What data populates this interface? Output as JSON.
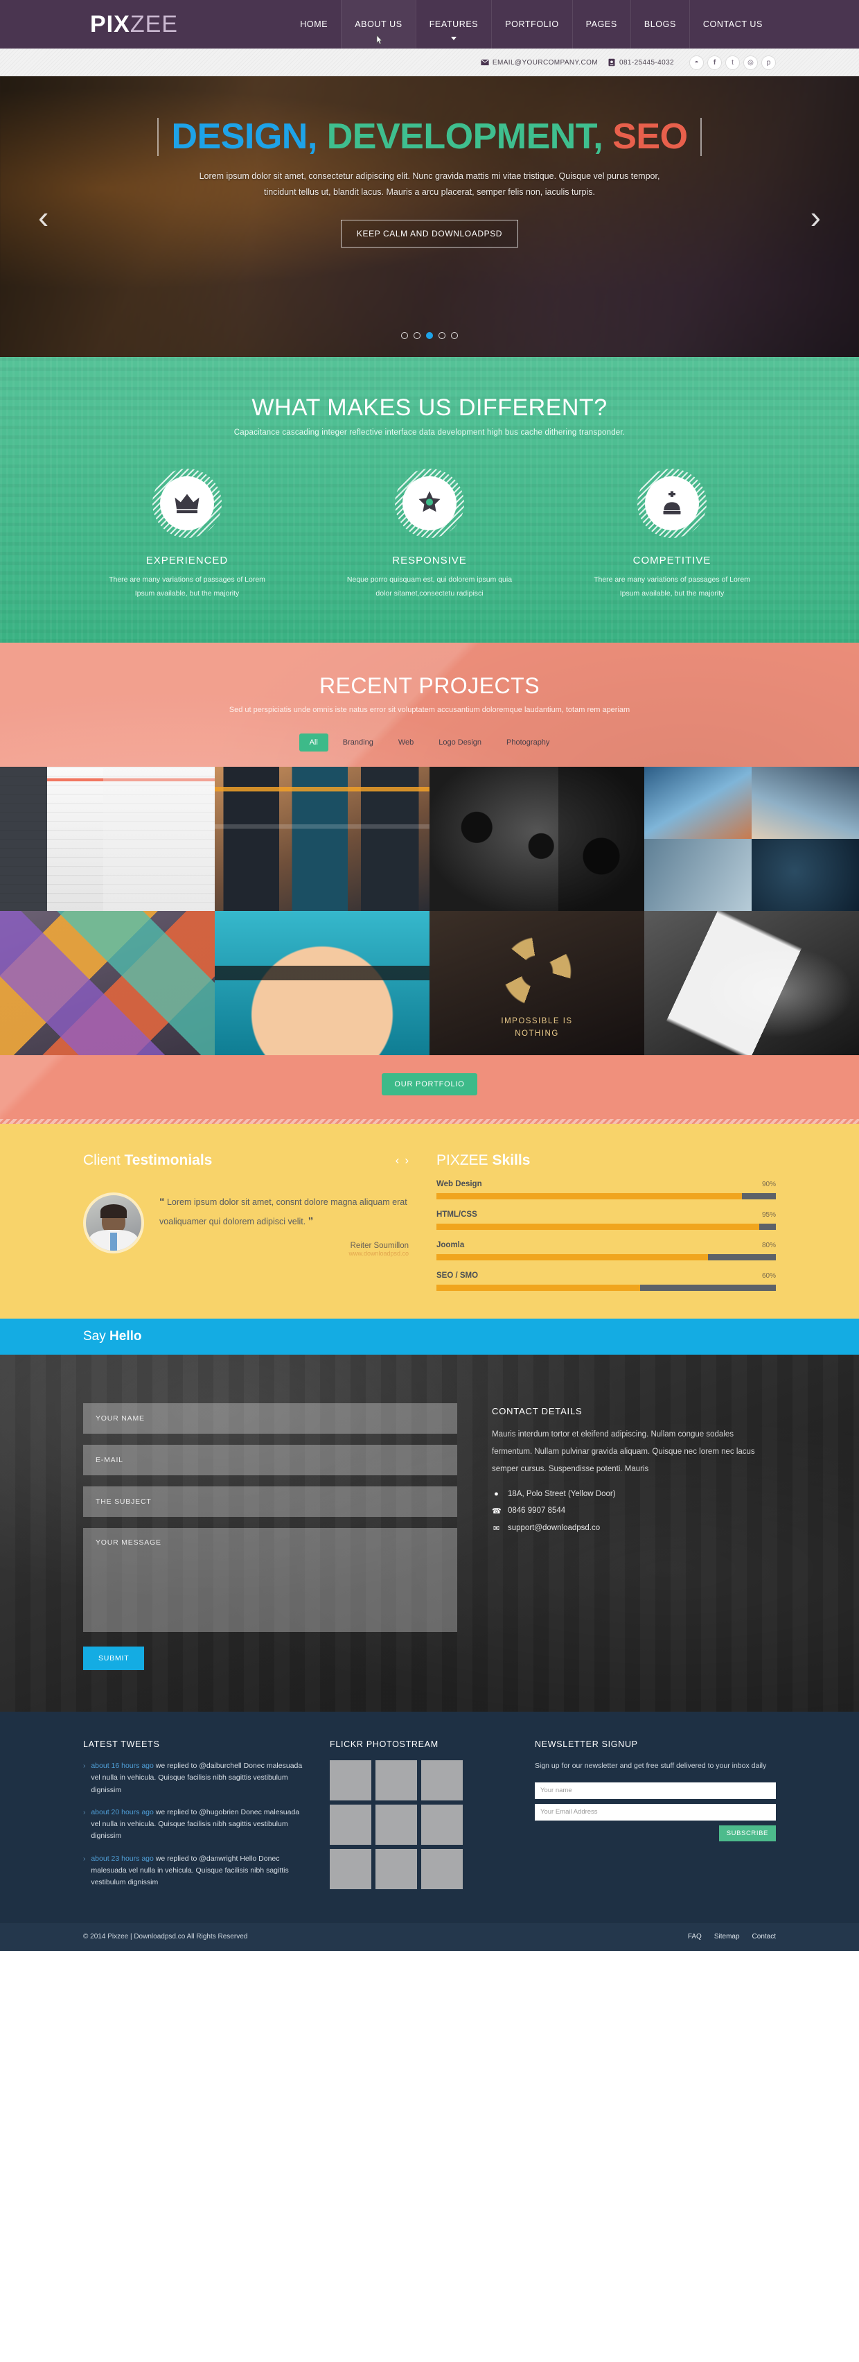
{
  "header": {
    "logo_bold": "PIX",
    "logo_light": "ZEE",
    "nav": [
      {
        "label": "HOME",
        "active": false,
        "caret": false
      },
      {
        "label": "ABOUT US",
        "active": true,
        "caret": false
      },
      {
        "label": "FEATURES",
        "active": false,
        "caret": true
      },
      {
        "label": "PORTFOLIO",
        "active": false,
        "caret": false
      },
      {
        "label": "PAGES",
        "active": false,
        "caret": false
      },
      {
        "label": "BLOGS",
        "active": false,
        "caret": false
      },
      {
        "label": "CONTACT US",
        "active": false,
        "caret": false
      }
    ],
    "bg_color": "#4a3550"
  },
  "utilbar": {
    "email": "EMAIL@YOURCOMPANY.COM",
    "phone": "081-25445-4032",
    "social": [
      "rss",
      "facebook",
      "twitter",
      "dribbble",
      "pinterest"
    ]
  },
  "slider": {
    "title_part1": "DESIGN,",
    "title_part2": "DEVELOPMENT,",
    "title_part3": "SEO",
    "subtitle": "Lorem ipsum dolor sit amet, consectetur adipiscing elit. Nunc gravida mattis mi vitae tristique. Quisque vel purus tempor, tincidunt tellus ut, blandit lacus. Mauris a arcu placerat, semper felis non, iaculis turpis.",
    "button": "KEEP CALM AND DOWNLOADPSD",
    "prev": "‹",
    "next": "›",
    "dot_count": 5,
    "active_dot": 2,
    "colors": {
      "c1": "#1ea3e8",
      "c2": "#3fbf8f",
      "c3": "#e8604c"
    }
  },
  "different": {
    "title": "WHAT MAKES US DIFFERENT?",
    "subtitle": "Capacitance cascading integer reflective interface data development high bus cache dithering transponder.",
    "bg_color": "#3dba89",
    "columns": [
      {
        "icon": "crown-icon",
        "heading": "EXPERIENCED",
        "text": "There are many variations of passages of Lorem Ipsum available, but the majority"
      },
      {
        "icon": "star-badge-icon",
        "heading": "RESPONSIVE",
        "text": "Neque porro quisquam est, qui dolorem ipsum quia dolor sitamet,consectetu radipisci"
      },
      {
        "icon": "chess-king-icon",
        "heading": "COMPETITIVE",
        "text": "There are many variations of passages of Lorem Ipsum available, but the majority"
      }
    ]
  },
  "projects": {
    "title": "RECENT PROJECTS",
    "subtitle": "Sed ut perspiciatis unde omnis iste natus error sit voluptatem accusantium doloremque laudantium, totam rem aperiam",
    "bg_color": "#f0907c",
    "filters": [
      {
        "label": "All",
        "active": true
      },
      {
        "label": "Branding",
        "active": false
      },
      {
        "label": "Web",
        "active": false
      },
      {
        "label": "Logo Design",
        "active": false
      },
      {
        "label": "Photography",
        "active": false
      }
    ],
    "impossible_line1": "IMPOSSIBLE IS",
    "impossible_line2": "NOTHING",
    "button": "OUR PORTFOLIO"
  },
  "testimonials": {
    "title_light": "Client ",
    "title_bold": "Testimonials",
    "prev": "‹",
    "next": "›",
    "quote": "Lorem ipsum dolor sit amet, consnt dolore magna aliquam erat voaliquamer qui dolorem adipisci velit.",
    "author": "Reiter Soumillon",
    "author_site": "www.downloadpsd.co",
    "bg_color": "#f8d36a"
  },
  "skills": {
    "title_light": "PIXZEE ",
    "title_bold": "Skills",
    "items": [
      {
        "name": "Web Design",
        "value": "90%",
        "pct": 90
      },
      {
        "name": "HTML/CSS",
        "value": "95%",
        "pct": 95
      },
      {
        "name": "Joomla",
        "value": "80%",
        "pct": 80
      },
      {
        "name": "SEO / SMO",
        "value": "60%",
        "pct": 60
      }
    ],
    "bar_color": "#f0a51e",
    "track_color": "#5d6268"
  },
  "hello": {
    "title_light": "Say ",
    "title_bold": "Hello",
    "bg_color": "#14ace3"
  },
  "contact": {
    "fields": {
      "name": "YOUR NAME",
      "email": "E-MAIL",
      "subject": "THE SUBJECT",
      "message": "YOUR MESSAGE"
    },
    "submit": "SUBMIT",
    "details_heading": "CONTACT DETAILS",
    "details_text": "Mauris interdum tortor et eleifend adipiscing. Nullam congue sodales fermentum. Nullam pulvinar gravida aliquam. Quisque nec lorem nec lacus semper cursus. Suspendisse potenti. Mauris",
    "address": "18A, Polo Street (Yellow Door)",
    "phone": "0846 9907 8544",
    "email": "support@downloadpsd.co"
  },
  "footer": {
    "tweets_heading": "LATEST TWEETS",
    "tweets": [
      {
        "time": "about 16 hours ago",
        "text": " we replied to @daiburchell Donec malesuada vel nulla in vehicula. Quisque facilisis nibh sagittis vestibulum dignissim"
      },
      {
        "time": "about 20 hours ago",
        "text": " we replied to @hugobrien Donec malesuada vel nulla in vehicula. Quisque facilisis nibh sagittis vestibulum dignissim"
      },
      {
        "time": "about 23 hours ago",
        "text": " we replied to @danwright Hello Donec malesuada vel nulla in vehicula. Quisque facilisis nibh sagittis vestibulum dignissim"
      }
    ],
    "flickr_heading": "FLICKR PHOTOSTREAM",
    "flickr_count": 9,
    "newsletter_heading": "NEWSLETTER SIGNUP",
    "newsletter_text": "Sign up for our newsletter and get free stuff delivered to your inbox daily",
    "newsletter_name_placeholder": "Your name",
    "newsletter_email_placeholder": "Your Email Address",
    "subscribe": "SUBSCRIBE",
    "copyright": "© 2014 Pixzee | Downloadpsd.co All Rights Reserved",
    "links": [
      "FAQ",
      "Sitemap",
      "Contact"
    ],
    "bg_color": "#1e3044"
  }
}
